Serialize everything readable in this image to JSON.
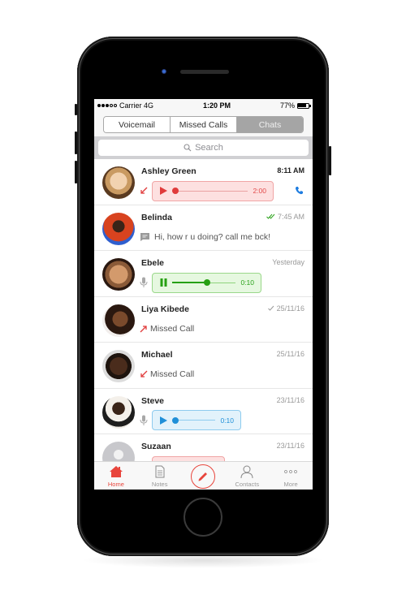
{
  "status_bar": {
    "carrier": "Carrier 4G",
    "time": "1:20 PM",
    "battery": "77%",
    "battery_level": 0.77,
    "signal_bars_filled": 3,
    "signal_bars_total": 5
  },
  "segments": [
    {
      "label": "Voicemail",
      "active": false
    },
    {
      "label": "Missed Calls",
      "active": false
    },
    {
      "label": "Chats",
      "active": true
    }
  ],
  "search": {
    "placeholder": "Search"
  },
  "chats": [
    {
      "name": "Ashley Green",
      "time": "8:11 AM",
      "time_bold": true,
      "type": "voice",
      "voice_color": "red",
      "direction": "incoming",
      "duration": "2:00",
      "progress": 0.0,
      "trailing_icon": "phone-icon",
      "avatar_colors": [
        "#e9c9a2",
        "#6b4a30"
      ]
    },
    {
      "name": "Belinda",
      "time": "7:45 AM",
      "status": "read-double-check",
      "type": "text",
      "message": "Hi, how r u doing? call me bck!",
      "avatar_colors": [
        "#d8431f",
        "#2a1a12"
      ]
    },
    {
      "name": "Ebele",
      "time": "Yesterday",
      "type": "voice",
      "voice_color": "green",
      "playing": true,
      "duration": "0:10",
      "progress": 0.55,
      "leading_icon": "microphone-icon",
      "avatar_colors": [
        "#c48a5e",
        "#3a2214"
      ]
    },
    {
      "name": "Liya Kibede",
      "time": "25/11/16",
      "status": "sent-check",
      "type": "missed",
      "direction": "outgoing",
      "message": "Missed Call",
      "avatar_colors": [
        "#e8e4e2",
        "#5a3520"
      ]
    },
    {
      "name": "Michael",
      "time": "25/11/16",
      "type": "missed",
      "direction": "incoming",
      "message": "Missed Call",
      "avatar_colors": [
        "#d8d8d8",
        "#3a2418"
      ]
    },
    {
      "name": "Steve",
      "time": "23/11/16",
      "type": "voice",
      "voice_color": "blue",
      "playing": false,
      "duration": "0:10",
      "progress": 0.0,
      "leading_icon": "microphone-icon",
      "avatar_colors": [
        "#f0ece8",
        "#2a1c14"
      ]
    },
    {
      "name": "Suzaan",
      "time": "23/11/16",
      "type": "voice",
      "voice_color": "red",
      "avatar_placeholder": true
    }
  ],
  "tab_bar": [
    {
      "label": "Home",
      "icon": "home-icon",
      "active": true
    },
    {
      "label": "Notes",
      "icon": "notes-icon",
      "active": false
    },
    {
      "label": "",
      "icon": "compose-pencil-icon",
      "active": false
    },
    {
      "label": "Contacts",
      "icon": "contacts-icon",
      "active": false
    },
    {
      "label": "More",
      "icon": "more-icon",
      "active": false
    }
  ],
  "colors": {
    "accent": "#e8453c",
    "voice_red": "#e03b3b",
    "voice_green": "#26a012",
    "voice_blue": "#1f8fd8",
    "segment_active": "#a5a5a5"
  }
}
